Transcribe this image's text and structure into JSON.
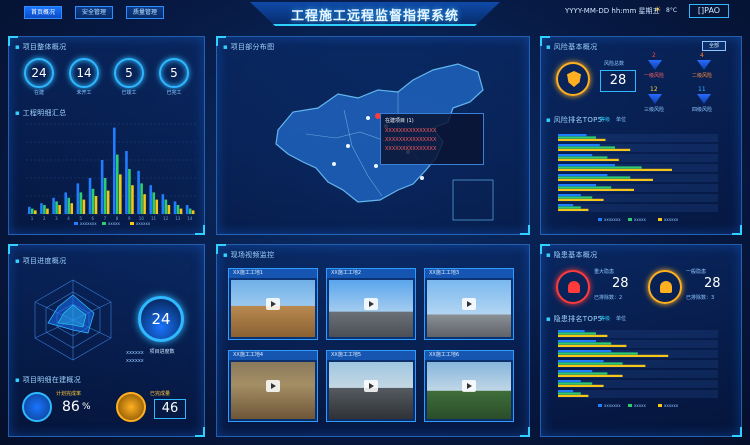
{
  "header": {
    "title": "工程施工远程监督指挥系统",
    "nav": [
      "首页概况",
      "安全管理",
      "质量管理"
    ],
    "datetime": "YYYY-MM-DD hh:mm 星期五",
    "weather_temp": "8°C",
    "logout": "[]PAO"
  },
  "project_overview": {
    "title": "项目整体概况",
    "rings": [
      {
        "value": "24",
        "label": "在建"
      },
      {
        "value": "14",
        "label": "未开工"
      },
      {
        "value": "5",
        "label": "已竣工"
      },
      {
        "value": "5",
        "label": "已完工"
      }
    ]
  },
  "bar_panel": {
    "title": "工程明细汇总",
    "legend": [
      "xxxxxxx",
      "xxxxx",
      "xxxxxx"
    ]
  },
  "chart_data": {
    "type": "bar",
    "categories": [
      "1",
      "2",
      "3",
      "4",
      "5",
      "6",
      "7",
      "8",
      "9",
      "10",
      "11",
      "12",
      "13",
      "14"
    ],
    "series": [
      {
        "name": "xxxxxxx",
        "values": [
          4,
          6,
          9,
          12,
          17,
          20,
          30,
          48,
          35,
          24,
          16,
          11,
          7,
          5
        ]
      },
      {
        "name": "xxxxx",
        "values": [
          3,
          5,
          7,
          9,
          12,
          14,
          20,
          33,
          25,
          17,
          12,
          8,
          5,
          3
        ]
      },
      {
        "name": "xxxxxx",
        "values": [
          2,
          3,
          5,
          6,
          8,
          10,
          13,
          22,
          16,
          11,
          8,
          5,
          3,
          2
        ]
      }
    ],
    "colors": [
      "#1f7dff",
      "#2ecc71",
      "#f5c518"
    ]
  },
  "map": {
    "title": "项目部分布图",
    "popup_title": "在建项目 (1)",
    "popup_items": [
      "XXXXXXXXXXXXXXX",
      "XXXXXXXXXXXXXXX",
      "XXXXXXXXXXXXXXX",
      "XXXXXXXXXXXXXXX"
    ]
  },
  "risk": {
    "title": "风险基本概况",
    "total_label": "风险总数",
    "total": "28",
    "filter": "全部",
    "levels": [
      {
        "value": "2",
        "label": "一级风险"
      },
      {
        "value": "4",
        "label": "二级风险"
      },
      {
        "value": "12",
        "label": "三级风险"
      },
      {
        "value": "11",
        "label": "四级风险"
      }
    ],
    "top_title": "风险排名TOP5",
    "tabs": [
      "等级",
      "单位"
    ]
  },
  "risk_bars": {
    "values": [
      [
        15,
        20,
        25
      ],
      [
        22,
        30,
        38
      ],
      [
        18,
        26,
        32
      ],
      [
        30,
        44,
        60
      ],
      [
        26,
        38,
        50
      ],
      [
        20,
        28,
        40
      ],
      [
        12,
        18,
        24
      ],
      [
        8,
        12,
        16
      ]
    ],
    "legend": [
      "xxxxxxx",
      "xxxxx",
      "xxxxxx"
    ]
  },
  "progress": {
    "title": "项目进度概况",
    "gauge_value": "24",
    "gauge_label": "项目进度数",
    "legend_a": "xxxxxx",
    "legend_b": "xxxxxx",
    "section_title": "项目明细在建概况",
    "kpi": [
      {
        "label": "计划完成率",
        "value": "86",
        "unit": "%"
      },
      {
        "label": "已完成量",
        "value": "46",
        "unit": ""
      }
    ]
  },
  "video": {
    "title": "现场视频监控",
    "cams": [
      "XX施工工地1",
      "XX施工工地2",
      "XX施工工地3",
      "XX施工工地4",
      "XX施工工地5",
      "XX施工工地6"
    ]
  },
  "quality": {
    "title": "隐患基本概况",
    "cards": [
      {
        "label": "重大隐患",
        "value": "28",
        "sub": "已排除数：2"
      },
      {
        "label": "一般隐患",
        "value": "28",
        "sub": "已排除数：3"
      }
    ],
    "top_title": "隐患排名TOP5",
    "tabs": [
      "等级",
      "单位"
    ],
    "legend": [
      "xxxxxxx",
      "xxxxx",
      "xxxxxx"
    ]
  },
  "quality_bars": {
    "values": [
      [
        14,
        20,
        26
      ],
      [
        20,
        28,
        36
      ],
      [
        28,
        42,
        58
      ],
      [
        24,
        34,
        46
      ],
      [
        18,
        26,
        34
      ],
      [
        12,
        18,
        24
      ],
      [
        8,
        12,
        16
      ]
    ]
  }
}
